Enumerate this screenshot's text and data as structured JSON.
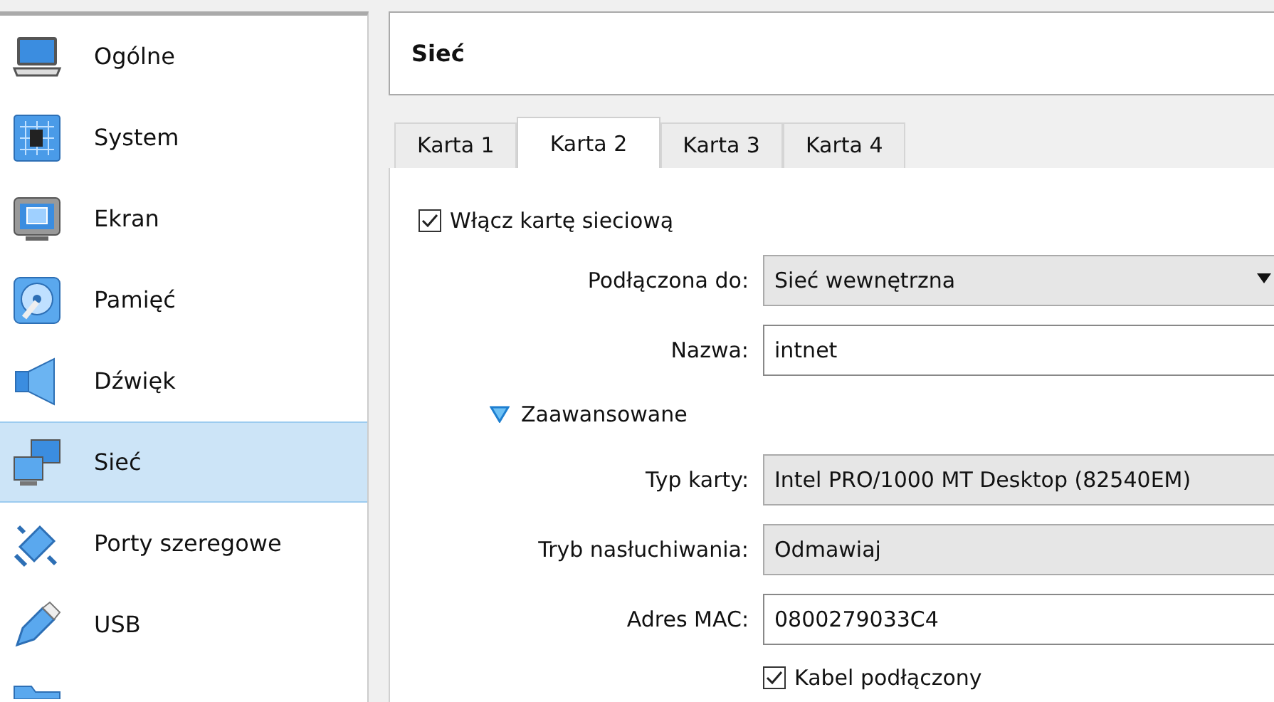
{
  "sidebar": {
    "items": [
      {
        "label": "Ogólne",
        "kind": "laptop",
        "selected": false
      },
      {
        "label": "System",
        "kind": "chip",
        "selected": false
      },
      {
        "label": "Ekran",
        "kind": "monitor",
        "selected": false
      },
      {
        "label": "Pamięć",
        "kind": "disk",
        "selected": false
      },
      {
        "label": "Dźwięk",
        "kind": "speaker",
        "selected": false
      },
      {
        "label": "Sieć",
        "kind": "network",
        "selected": true
      },
      {
        "label": "Porty szeregowe",
        "kind": "serial",
        "selected": false
      },
      {
        "label": "USB",
        "kind": "usb",
        "selected": false
      },
      {
        "kind": "folder",
        "selected": false
      }
    ]
  },
  "header": {
    "title": "Sieć"
  },
  "tabs": [
    {
      "label": "Karta 1",
      "selected": false
    },
    {
      "label": "Karta 2",
      "selected": true
    },
    {
      "label": "Karta 3",
      "selected": false
    },
    {
      "label": "Karta 4",
      "selected": false
    }
  ],
  "enable_adapter": {
    "label": "Włącz kartę sieciową",
    "checked": true
  },
  "fields": [
    {
      "label": "Podłączona do:",
      "value": "Sieć wewnętrzna",
      "kind": "combo",
      "disabled": false
    },
    {
      "label": "Nazwa:",
      "value": "intnet",
      "kind": "text",
      "disabled": false
    }
  ],
  "advanced": {
    "label": "Zaawansowane",
    "expanded": true
  },
  "advanced_fields": [
    {
      "label": "Typ karty:",
      "value": "Intel PRO/1000 MT Desktop (82540EM)",
      "kind": "combo",
      "disabled": true
    },
    {
      "label": "Tryb nasłuchiwania:",
      "value": "Odmawiaj",
      "kind": "combo",
      "disabled": true
    },
    {
      "label": "Adres MAC:",
      "value": "0800279033C4",
      "kind": "text",
      "disabled": false
    }
  ],
  "cable_connected": {
    "label": "Kabel podłączony",
    "checked": true
  }
}
